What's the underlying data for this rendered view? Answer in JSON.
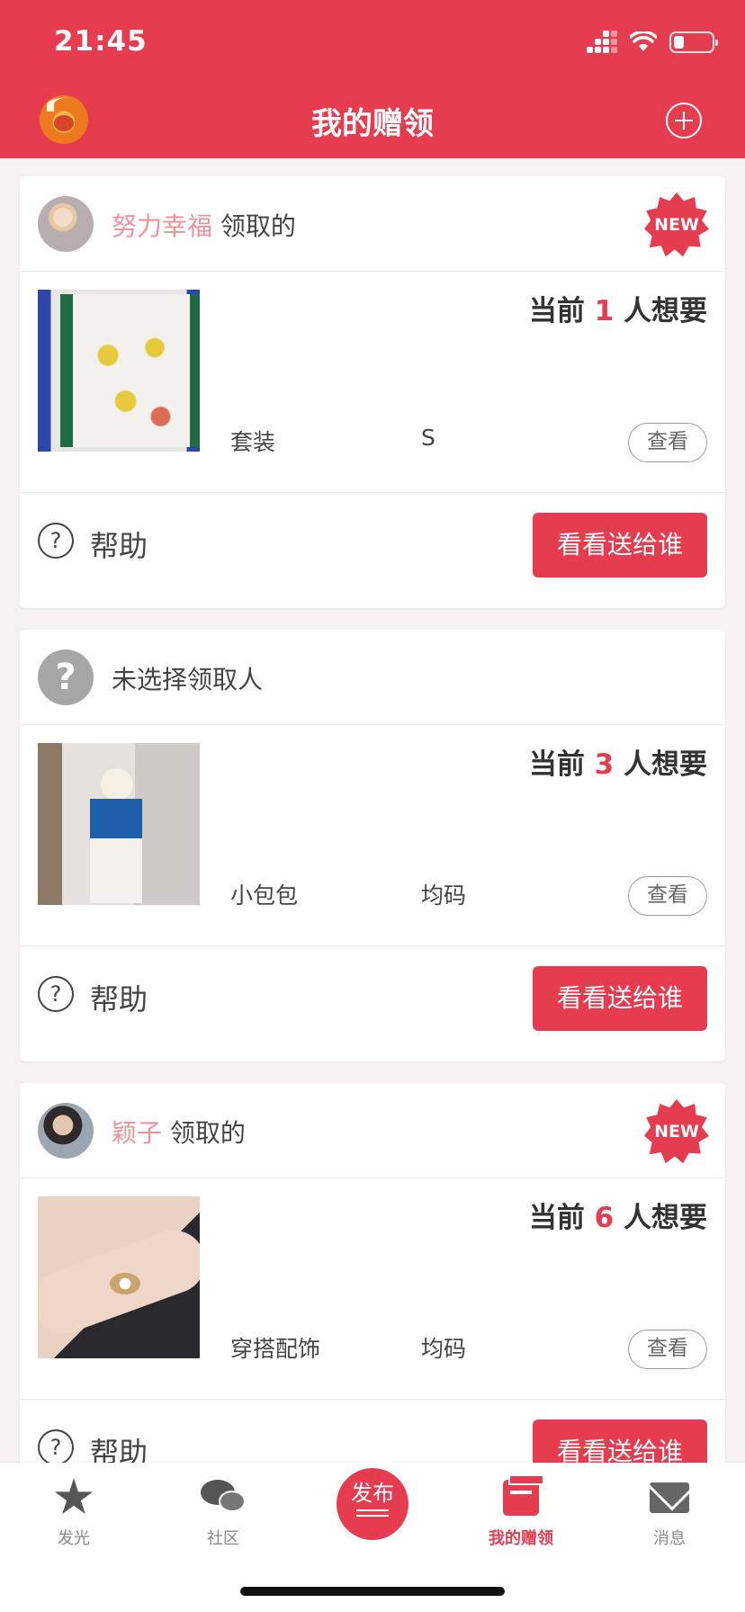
{
  "status_bar": {
    "time": "21:45",
    "battery_level": 0.25
  },
  "header": {
    "title": "我的赠领"
  },
  "cards": [
    {
      "has_user": true,
      "user_name": "努力幸福",
      "action": " 领取的",
      "is_new": true,
      "badge": "NEW",
      "want_prefix": "当前 ",
      "want_count": "1",
      "want_suffix": " 人想要",
      "category": "套装",
      "size": "S",
      "view_label": "查看",
      "help_label": "帮助",
      "give_label": "看看送给谁"
    },
    {
      "has_user": false,
      "no_user_text": "未选择领取人",
      "placeholder_glyph": "?",
      "want_prefix": "当前 ",
      "want_count": "3",
      "want_suffix": " 人想要",
      "category": "小包包",
      "size": "均码",
      "view_label": "查看",
      "help_label": "帮助",
      "give_label": "看看送给谁"
    },
    {
      "has_user": true,
      "user_name": "颖子",
      "action": " 领取的",
      "is_new": true,
      "badge": "NEW",
      "want_prefix": "当前 ",
      "want_count": "6",
      "want_suffix": " 人想要",
      "category": "穿搭配饰",
      "size": "均码",
      "view_label": "查看",
      "help_label": "帮助",
      "give_label": "看看送给谁"
    }
  ],
  "tabbar": {
    "items": [
      {
        "label": "发光",
        "icon": "star-icon"
      },
      {
        "label": "社区",
        "icon": "chat-bubbles-icon"
      },
      {
        "label": "发布",
        "icon": "publish-button"
      },
      {
        "label": "我的赠领",
        "icon": "gift-box-icon",
        "active": true
      },
      {
        "label": "消息",
        "icon": "envelope-icon"
      }
    ]
  },
  "colors": {
    "accent": "#e63c50",
    "name": "#f09098",
    "background": "#f6f2f3"
  }
}
